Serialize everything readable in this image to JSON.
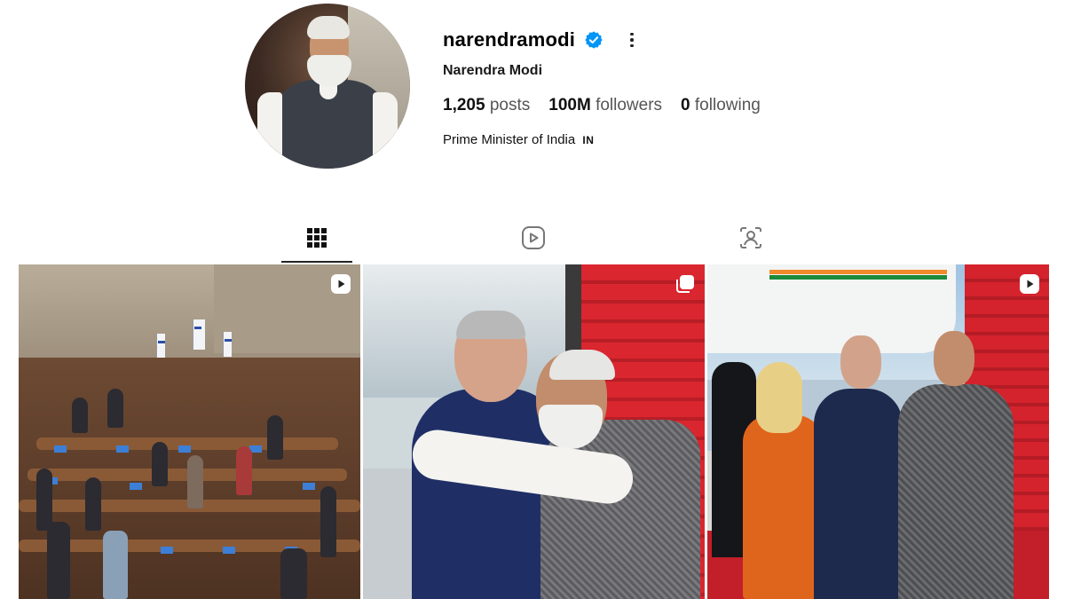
{
  "profile": {
    "username": "narendramodi",
    "full_name": "Narendra Modi",
    "stats": {
      "posts_count": "1,205",
      "posts_label": "posts",
      "followers_count": "100M",
      "followers_label": "followers",
      "following_count": "0",
      "following_label": "following"
    },
    "bio": "Prime Minister of India",
    "bio_flag": "IN",
    "verified_color": "#0095f6"
  },
  "tabs": [
    {
      "icon": "grid-icon",
      "selected": true
    },
    {
      "icon": "reels-icon",
      "selected": false
    },
    {
      "icon": "tagged-icon",
      "selected": false
    }
  ],
  "posts": [
    {
      "type": "reel",
      "badge_icon": "reel-badge-icon"
    },
    {
      "type": "carousel",
      "badge_icon": "carousel-badge-icon"
    },
    {
      "type": "reel",
      "badge_icon": "reel-badge-icon"
    }
  ],
  "colors": {
    "text": "#000000",
    "secondary": "#555555"
  }
}
